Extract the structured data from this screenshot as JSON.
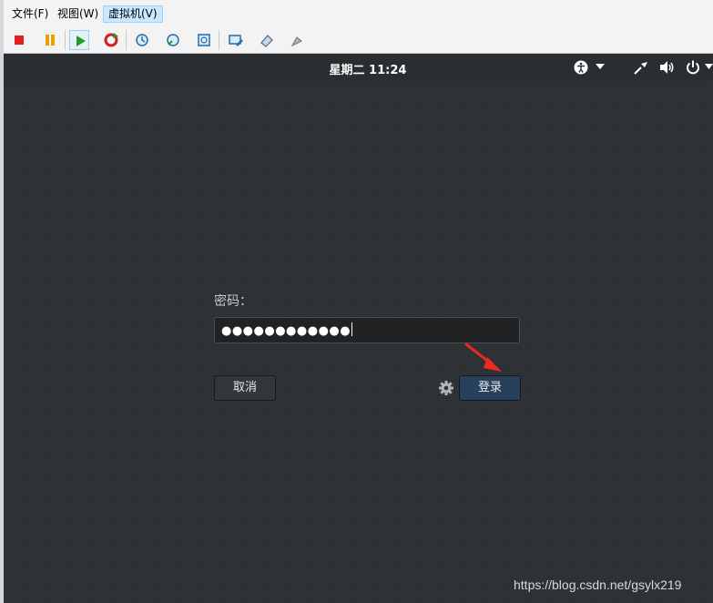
{
  "menubar": {
    "items": [
      {
        "label": "文件(F)"
      },
      {
        "label": "视图(W)"
      },
      {
        "label": "虚拟机(V)",
        "active": true
      }
    ]
  },
  "toolbar": {
    "buttons": [
      {
        "icon": "stop-icon",
        "color": "#e02020"
      },
      {
        "icon": "pause-icon",
        "color": "#e8a000"
      },
      {
        "icon": "play-icon",
        "color": "#20a020",
        "pressed": true
      },
      {
        "icon": "restart-icon",
        "color": "#d02020"
      },
      {
        "icon": "snapshot-icon"
      },
      {
        "icon": "snapshot-restore-icon"
      },
      {
        "icon": "snapshot-manager-icon"
      },
      {
        "icon": "edit-vm-icon"
      },
      {
        "icon": "vm-settings-icon"
      },
      {
        "icon": "vm-tools-icon"
      }
    ]
  },
  "guest": {
    "clock": "星期二 11:24",
    "tray": [
      "accessibility-icon",
      "chevron-down-icon",
      "network-wired-icon",
      "volume-icon",
      "power-icon",
      "chevron-down-icon"
    ],
    "password_label": "密码：",
    "password_value": "●●●●●●●●●●●●",
    "cancel_label": "取消",
    "login_label": "登录",
    "watermark": "https://blog.csdn.net/gsylx219"
  },
  "colors": {
    "background": "#2d3033",
    "login_button": "#27415d",
    "annotation_arrow": "#ee2a1c"
  }
}
